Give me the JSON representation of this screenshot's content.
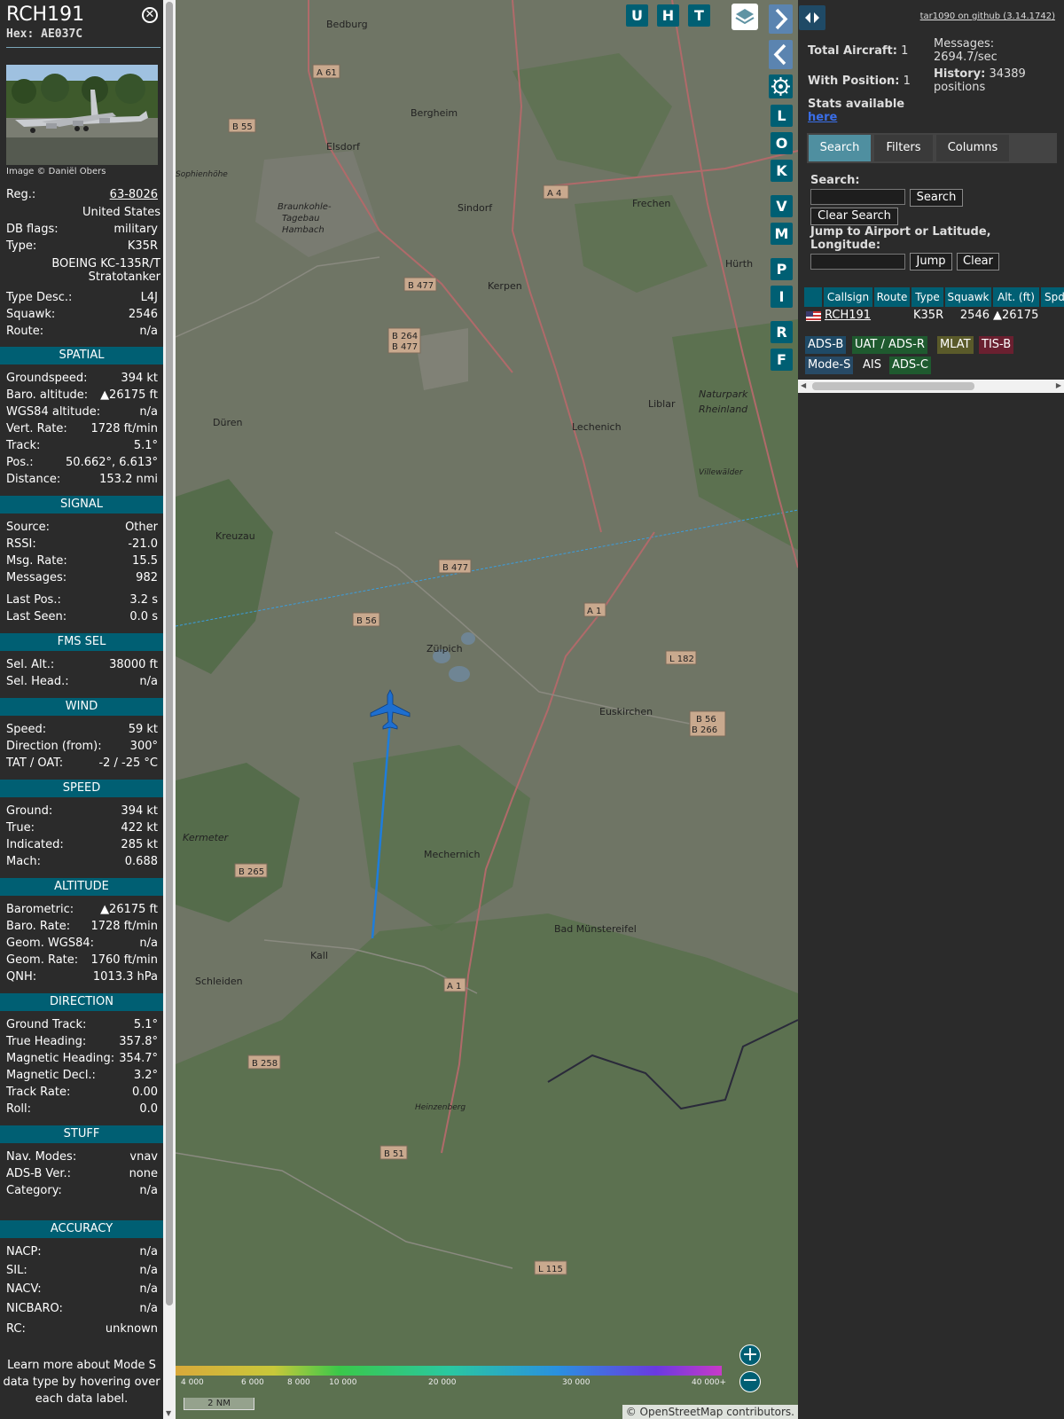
{
  "info": {
    "callsign": "RCH191",
    "hex": "Hex: AE037C",
    "photo_credit": "Image © Daniël Obers",
    "reg_label": "Reg.:",
    "reg_value": "63-8026",
    "country": "United States",
    "dbflags_label": "DB flags:",
    "dbflags_value": "military",
    "type_label": "Type:",
    "type_value": "K35R",
    "type_name_1": "BOEING KC-135R/T",
    "type_name_2": "Stratotanker",
    "typedesc_label": "Type Desc.:",
    "typedesc_value": "L4J",
    "squawk_label": "Squawk:",
    "squawk_value": "2546",
    "route_label": "Route:",
    "route_value": "n/a"
  },
  "sections": {
    "spatial": {
      "title": "SPATIAL",
      "rows": [
        {
          "k": "Groundspeed:",
          "v": "394 kt"
        },
        {
          "k": "Baro. altitude:",
          "v": "▲26175 ft"
        },
        {
          "k": "WGS84 altitude:",
          "v": "n/a"
        },
        {
          "k": "Vert. Rate:",
          "v": "1728 ft/min"
        },
        {
          "k": "Track:",
          "v": "5.1°"
        },
        {
          "k": "Pos.:",
          "v": "50.662°, 6.613°"
        },
        {
          "k": "Distance:",
          "v": "153.2 nmi"
        }
      ]
    },
    "signal": {
      "title": "SIGNAL",
      "rows": [
        {
          "k": "Source:",
          "v": "Other"
        },
        {
          "k": "RSSI:",
          "v": "-21.0"
        },
        {
          "k": "Msg. Rate:",
          "v": "15.5"
        },
        {
          "k": "Messages:",
          "v": "982"
        },
        {
          "k": "Last Pos.:",
          "v": "3.2 s"
        },
        {
          "k": "Last Seen:",
          "v": "0.0 s"
        }
      ]
    },
    "fms": {
      "title": "FMS SEL",
      "rows": [
        {
          "k": "Sel. Alt.:",
          "v": "38000 ft"
        },
        {
          "k": "Sel. Head.:",
          "v": "n/a"
        }
      ]
    },
    "wind": {
      "title": "WIND",
      "rows": [
        {
          "k": "Speed:",
          "v": "59 kt"
        },
        {
          "k": "Direction (from):",
          "v": "300°"
        },
        {
          "k": "TAT / OAT:",
          "v": "-2 / -25 °C"
        }
      ]
    },
    "speed": {
      "title": "SPEED",
      "rows": [
        {
          "k": "Ground:",
          "v": "394 kt"
        },
        {
          "k": "True:",
          "v": "422 kt"
        },
        {
          "k": "Indicated:",
          "v": "285 kt"
        },
        {
          "k": "Mach:",
          "v": "0.688"
        }
      ]
    },
    "altitude": {
      "title": "ALTITUDE",
      "rows": [
        {
          "k": "Barometric:",
          "v": "▲26175 ft"
        },
        {
          "k": "Baro. Rate:",
          "v": "1728 ft/min"
        },
        {
          "k": "Geom. WGS84:",
          "v": "n/a"
        },
        {
          "k": "Geom. Rate:",
          "v": "1760 ft/min"
        },
        {
          "k": "QNH:",
          "v": "1013.3 hPa"
        }
      ]
    },
    "direction": {
      "title": "DIRECTION",
      "rows": [
        {
          "k": "Ground Track:",
          "v": "5.1°"
        },
        {
          "k": "True Heading:",
          "v": "357.8°"
        },
        {
          "k": "Magnetic Heading:",
          "v": "354.7°"
        },
        {
          "k": "Magnetic Decl.:",
          "v": "3.2°"
        },
        {
          "k": "Track Rate:",
          "v": "0.00"
        },
        {
          "k": "Roll:",
          "v": "0.0"
        }
      ]
    },
    "stuff": {
      "title": "STUFF",
      "rows": [
        {
          "k": "Nav. Modes:",
          "v": "vnav"
        },
        {
          "k": "ADS-B Ver.:",
          "v": "none"
        },
        {
          "k": "Category:",
          "v": "n/a"
        }
      ]
    },
    "accuracy": {
      "title": "ACCURACY",
      "rows": [
        {
          "k": "NACP:",
          "v": "n/a"
        },
        {
          "k": "SIL:",
          "v": "n/a"
        },
        {
          "k": "NACV:",
          "v": "n/a"
        },
        {
          "k": "NICBARO:",
          "v": "n/a"
        },
        {
          "k": "RC:",
          "v": "unknown"
        }
      ]
    },
    "learn_more": "Learn more about Mode S data type by hovering over each data label."
  },
  "map": {
    "buttons_top": [
      "U",
      "H",
      "T"
    ],
    "buttons_side": [
      "L",
      "O",
      "K",
      "V",
      "M",
      "P",
      "I",
      "R",
      "F"
    ],
    "places": [
      "Bedburg",
      "Bergheim",
      "Elsdorf",
      "Sindorf",
      "Frechen",
      "Kerpen",
      "Hürth",
      "Braunkohle-Tagebau Hambach",
      "Düren",
      "Lechenich",
      "Liblar",
      "Naturpark Rheinland",
      "Kreuzau",
      "Zülpich",
      "Euskirchen",
      "Mechernich",
      "Bad Münstereifel",
      "Kall",
      "Schleiden",
      "Kermeter",
      "Heinzenberg",
      "Sophienhöhe",
      "Villewälder"
    ],
    "roads": [
      "A 61",
      "B 55",
      "A 4",
      "B 477",
      "B 264",
      "B 477",
      "B 477",
      "B 56",
      "A 1",
      "L 182",
      "B 56",
      "B 266",
      "B 265",
      "A 1",
      "B 258",
      "B 51",
      "L 115"
    ],
    "altitude_scale": [
      "4 000",
      "6 000",
      "8 000",
      "10 000",
      "20 000",
      "30 000",
      "40 000+"
    ],
    "scale": "2 NM",
    "attribution_prefix": "©",
    "attribution_link": "OpenStreetMap",
    "attribution_suffix": "contributors."
  },
  "panel": {
    "github": "tar1090 on github (3.14.1742)",
    "total_aircraft_label": "Total Aircraft:",
    "total_aircraft": "1",
    "with_position_label": "With Position:",
    "with_position": "1",
    "messages_label": "Messages:",
    "messages_value": "2694.7/sec",
    "history_label": "History:",
    "history_value_1": "34389",
    "history_value_2": "positions",
    "stats_label": "Stats available",
    "stats_link": "here",
    "tabs": [
      "Search",
      "Filters",
      "Columns"
    ],
    "search_label": "Search:",
    "search_value": "",
    "search_button": "Search",
    "clear_search_button": "Clear Search",
    "jump_label_1": "Jump to Airport or Latitude,",
    "jump_label_2": "Longitude:",
    "jump_value": "",
    "jump_button": "Jump",
    "clear_button": "Clear",
    "columns": [
      "Callsign",
      "Route",
      "Type",
      "Squawk",
      "Alt. (ft)",
      "Spd"
    ],
    "table_rows": [
      {
        "callsign": "RCH191",
        "route": "",
        "type": "K35R",
        "squawk": "2546",
        "alt": "▲26175"
      }
    ],
    "source_badges": [
      {
        "label": "ADS-B",
        "bg": "#1f4a66"
      },
      {
        "label": "UAT / ADS-R",
        "bg": "#1f5a2f"
      },
      {
        "label": "MLAT",
        "bg": "#5a5a2a"
      },
      {
        "label": "TIS-B",
        "bg": "#6a2030"
      },
      {
        "label": "Mode-S",
        "bg": "#274a66"
      },
      {
        "label": "AIS",
        "bg": "transparent"
      },
      {
        "label": "ADS-C",
        "bg": "#1f5a2f"
      }
    ]
  }
}
